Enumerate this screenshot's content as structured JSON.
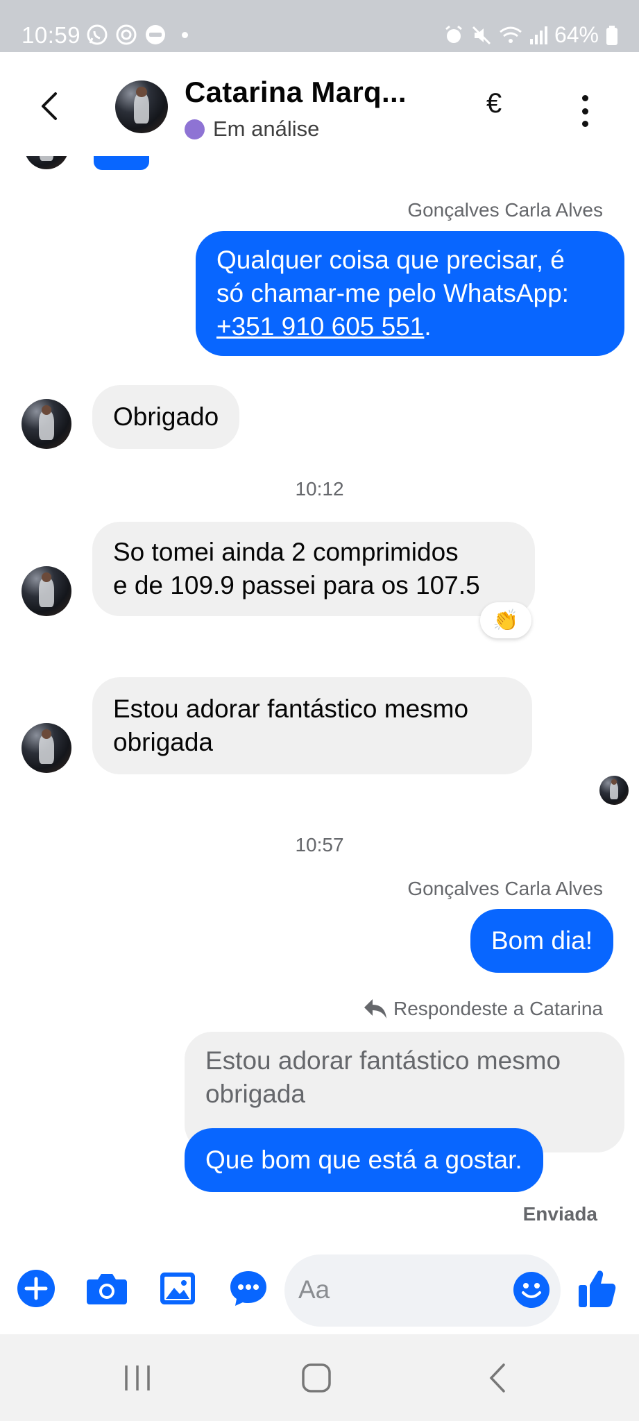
{
  "status_bar": {
    "time": "10:59",
    "battery": "64%"
  },
  "header": {
    "contact_name": "Catarina Marq...",
    "status": "Em análise",
    "status_color": "#8e73d4",
    "currency_symbol": "€"
  },
  "messages": {
    "msg1": {
      "sender": "Gonçalves Carla Alves",
      "line1": "Qualquer coisa que precisar, é",
      "line2": "só chamar-me pelo WhatsApp:",
      "phone": "+351 910 605 551",
      "suffix": "."
    },
    "msg2": {
      "text": "Obrigado"
    },
    "time1": "10:12",
    "msg3": {
      "line1": "So tomei ainda 2 comprimidos",
      "line2": "e de 109.9 passei para os 107.5",
      "reaction": "👏"
    },
    "msg4": {
      "line1": "Estou adorar fantástico mesmo",
      "line2": "obrigada"
    },
    "time2": "10:57",
    "msg5": {
      "sender": "Gonçalves Carla Alves",
      "text": "Bom dia!"
    },
    "msg6": {
      "reply_label": "Respondeste a Catarina",
      "quoted_line1": "Estou adorar fantástico mesmo",
      "quoted_line2": "obrigada",
      "text": "Que bom que está a gostar.",
      "delivery_status": "Enviada"
    }
  },
  "composer": {
    "placeholder": "Aa",
    "icons": [
      "plus-icon",
      "camera-icon",
      "image-icon",
      "chat-options-icon",
      "emoji-icon",
      "like-icon"
    ]
  },
  "colors": {
    "accent": "#0866ff",
    "incoming_bubble": "#f0f0f0",
    "status_bar": "#c9ccd1"
  }
}
